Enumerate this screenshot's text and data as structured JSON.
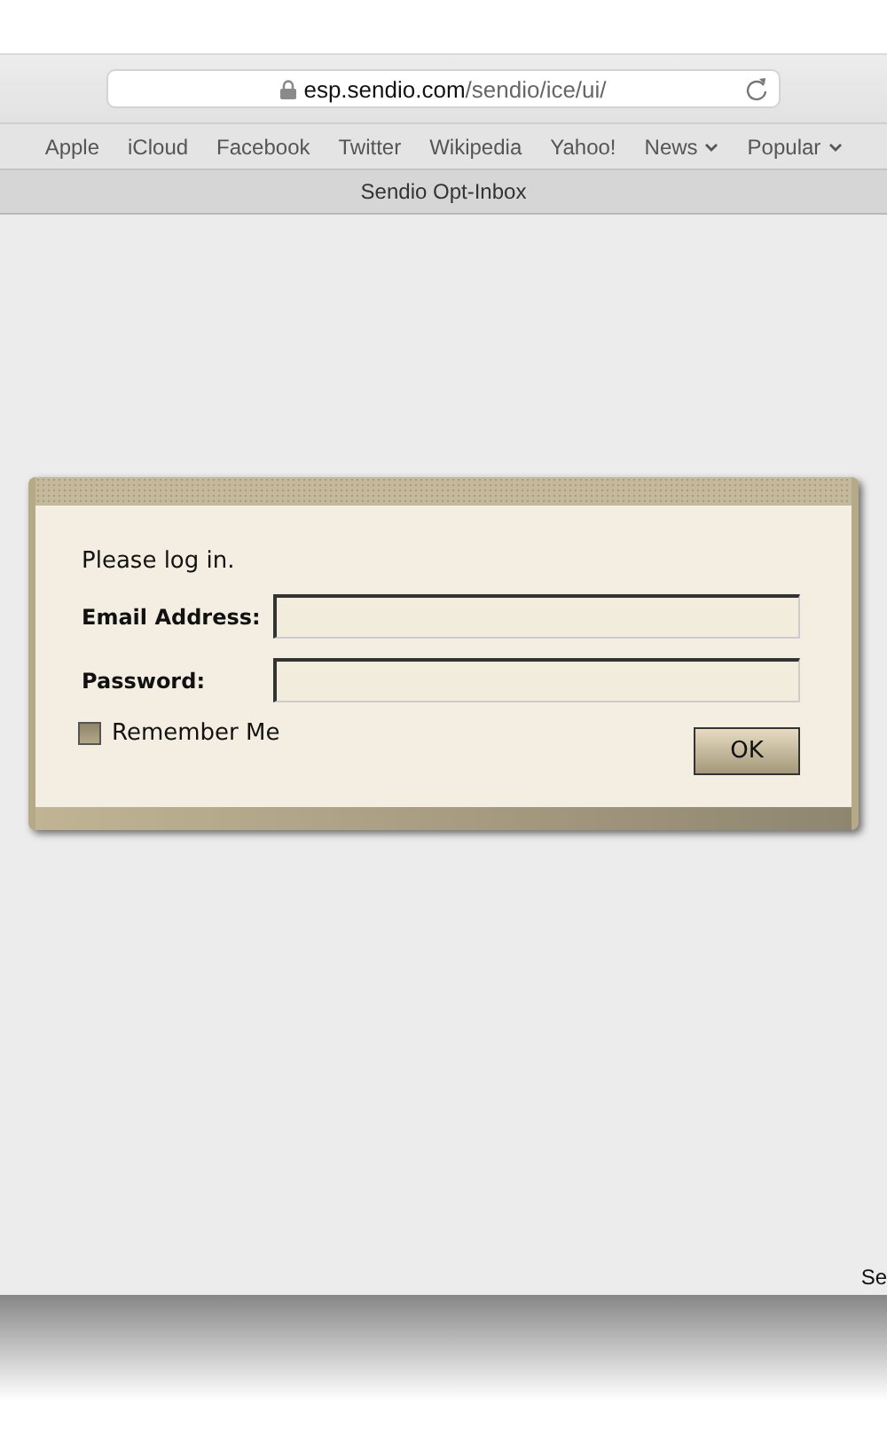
{
  "browser": {
    "url": {
      "secure": true,
      "domain": "esp.sendio.com",
      "path": "/sendio/ice/ui/"
    },
    "bookmarks": [
      {
        "label": "Apple",
        "kind": "link"
      },
      {
        "label": "iCloud",
        "kind": "link"
      },
      {
        "label": "Facebook",
        "kind": "link"
      },
      {
        "label": "Twitter",
        "kind": "link"
      },
      {
        "label": "Wikipedia",
        "kind": "link"
      },
      {
        "label": "Yahoo!",
        "kind": "link"
      },
      {
        "label": "News",
        "kind": "menu"
      },
      {
        "label": "Popular",
        "kind": "menu"
      }
    ],
    "tab_title": "Sendio Opt-Inbox"
  },
  "login": {
    "prompt": "Please log in.",
    "fields": [
      {
        "label": "Email Address:"
      },
      {
        "label": "Password:"
      }
    ],
    "remember": {
      "label": "Remember Me",
      "checked": false
    },
    "ok_button": "OK"
  },
  "footer_text": "Se"
}
